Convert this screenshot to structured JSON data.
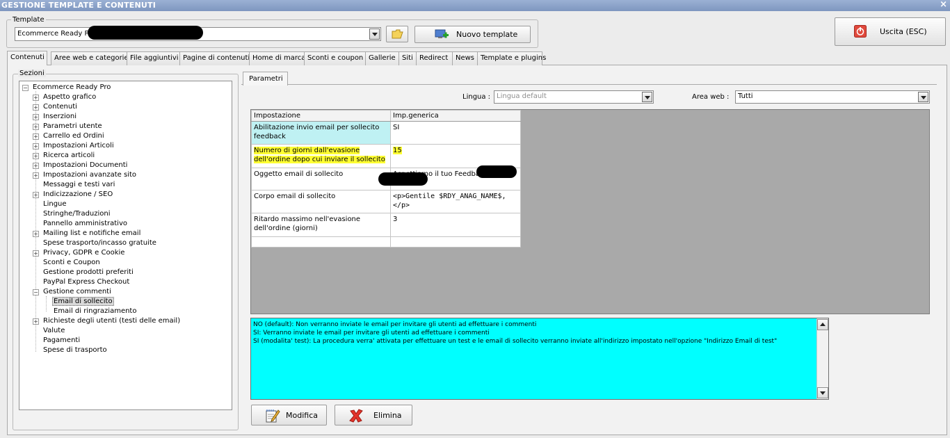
{
  "window": {
    "title": "GESTIONE TEMPLATE E CONTENUTI",
    "close_glyph": "×"
  },
  "template": {
    "group_label": "Template",
    "selected": "Ecommerce Ready Pr",
    "new_button": "Nuovo template",
    "folder_icon": "folder-open-icon",
    "new_icon": "monitor-add-icon"
  },
  "exit_button": {
    "label": "Uscita (ESC)",
    "icon": "power-icon"
  },
  "tabs": [
    {
      "label": "Contenuti"
    },
    {
      "label": "Aree web e categorie"
    },
    {
      "label": "File aggiuntivi"
    },
    {
      "label": "Pagine di contenuti"
    },
    {
      "label": "Home di marca"
    },
    {
      "label": "Sconti e coupon"
    },
    {
      "label": "Gallerie"
    },
    {
      "label": "Siti"
    },
    {
      "label": "Redirect"
    },
    {
      "label": "News"
    },
    {
      "label": "Template e plugins"
    }
  ],
  "sections": {
    "label": "Sezioni",
    "root": "Ecommerce Ready Pro",
    "items": [
      "Aspetto grafico",
      "Contenuti",
      "Inserzioni",
      "Parametri utente",
      "Carrello ed Ordini",
      "Impostazioni Articoli",
      "Ricerca articoli",
      "Impostazioni Documenti",
      "Impostazioni avanzate sito",
      "Messaggi e testi vari",
      "Indicizzazione / SEO",
      "Lingue",
      "Stringhe/Traduzioni",
      "Pannello amministrativo",
      "Mailing list e notifiche email",
      "Spese trasporto/incasso gratuite",
      "Privacy, GDPR e Cookie",
      "Sconti e Coupon",
      "Gestione prodotti preferiti",
      "PayPal Express Checkout",
      "Gestione commenti",
      "Email di sollecito",
      "Email di ringraziamento",
      "Richieste degli utenti (testi delle email)",
      "Valute",
      "Pagamenti",
      "Spese di trasporto"
    ]
  },
  "params": {
    "tab_label": "Parametri",
    "lingua_label": "Lingua :",
    "lingua_value": "Lingua default",
    "area_label": "Area web :",
    "area_value": "Tutti",
    "headers": [
      "Impostazione",
      "Imp.generica"
    ],
    "rows": [
      {
        "setting": "Abilitazione invio email per sollecito feedback",
        "value": "SI"
      },
      {
        "setting": "Numero di giorni dall'evasione dell'ordine dopo cui inviare il sollecito",
        "value": "15"
      },
      {
        "setting": "Oggetto email di sollecito",
        "value": "Aspettiamo il tuo Feedbac"
      },
      {
        "setting": "Corpo email di sollecito",
        "value": "<p>Gentile $RDY_ANAG_NAME$,</p>"
      },
      {
        "setting": "Ritardo massimo nell'evasione dell'ordine (giorni)",
        "value": "3"
      }
    ]
  },
  "help": {
    "lines": [
      "NO (default): Non verranno inviate le email per invitare gli utenti ad effettuare i commenti",
      "SI: Verranno inviate le email per invitare gli utenti ad effettuare i commenti",
      "SI (modalita' test): La procedura verra' attivata per effettuare un test e le email di sollecito verranno inviate all'indirizzo impostato nell'opzione \"Indirizzo Email di test\""
    ]
  },
  "actions": {
    "modify": "Modifica",
    "delete": "Elimina",
    "modify_icon": "notepad-pencil-icon",
    "delete_icon": "red-x-icon"
  },
  "colors": {
    "help_bg": "#00ffff",
    "cyan_cell": "#bff1f3",
    "highlight": "#ffff33",
    "grid_bg": "#a9a9a9",
    "title_bg": "#8aa2c9"
  }
}
